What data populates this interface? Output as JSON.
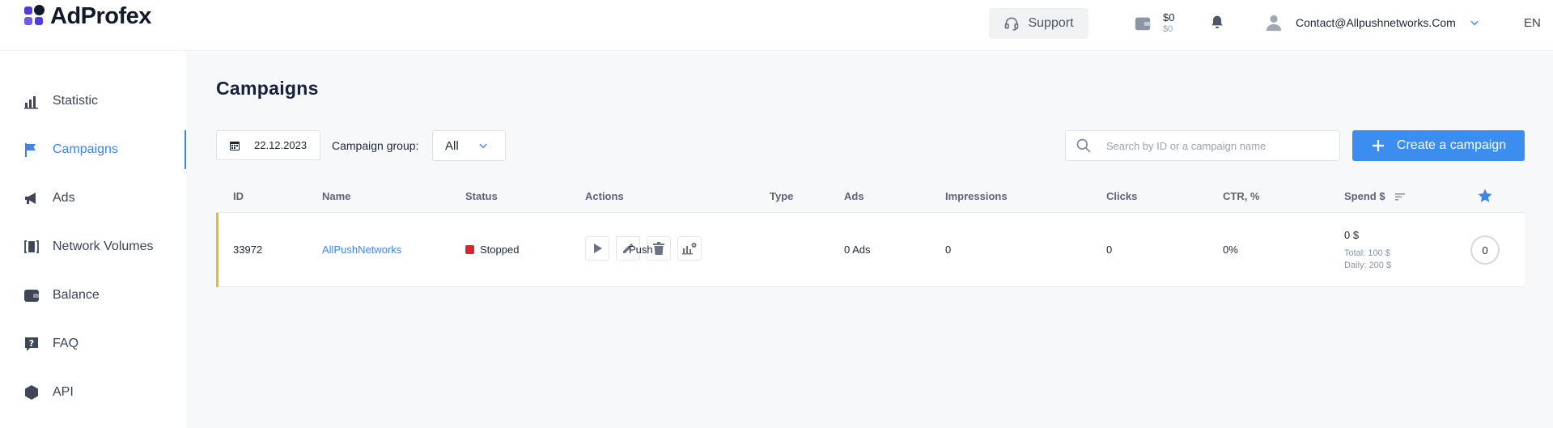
{
  "header": {
    "logo_text": "AdProfex",
    "support_label": "Support",
    "balance_main": "$0",
    "balance_sub": "$0",
    "user_email": "Contact@Allpushnetworks.Com",
    "language": "EN"
  },
  "sidebar": {
    "items": [
      {
        "label": "Statistic",
        "icon": "bar-chart-icon"
      },
      {
        "label": "Campaigns",
        "icon": "flag-icon",
        "active": true
      },
      {
        "label": "Ads",
        "icon": "megaphone-icon"
      },
      {
        "label": "Network Volumes",
        "icon": "network-volumes-icon"
      },
      {
        "label": "Balance",
        "icon": "wallet-icon"
      },
      {
        "label": "FAQ",
        "icon": "question-icon"
      },
      {
        "label": "API",
        "icon": "api-icon"
      }
    ]
  },
  "main": {
    "title": "Campaigns",
    "date": "22.12.2023",
    "group_label": "Campaign group:",
    "group_value": "All",
    "search_placeholder": "Search by ID or a campaign name",
    "create_label": "Create a campaign",
    "columns": [
      "ID",
      "Name",
      "Status",
      "Actions",
      "Type",
      "Ads",
      "Impressions",
      "Clicks",
      "CTR, %",
      "Spend $"
    ],
    "rows": [
      {
        "id": "33972",
        "name": "AllPushNetworks",
        "status": "Stopped",
        "type": "Push",
        "ads": "0 Ads",
        "impressions": "0",
        "clicks": "0",
        "ctr": "0%",
        "spend": "0 $",
        "spend_total": "Total: 100 $",
        "spend_daily": "Daily: 200 $",
        "favorite_count": "0"
      }
    ]
  },
  "colors": {
    "accent": "#3b86e8",
    "button": "#3b8ef0",
    "stopped": "#d9262e",
    "row_marker": "#f2b51d"
  }
}
